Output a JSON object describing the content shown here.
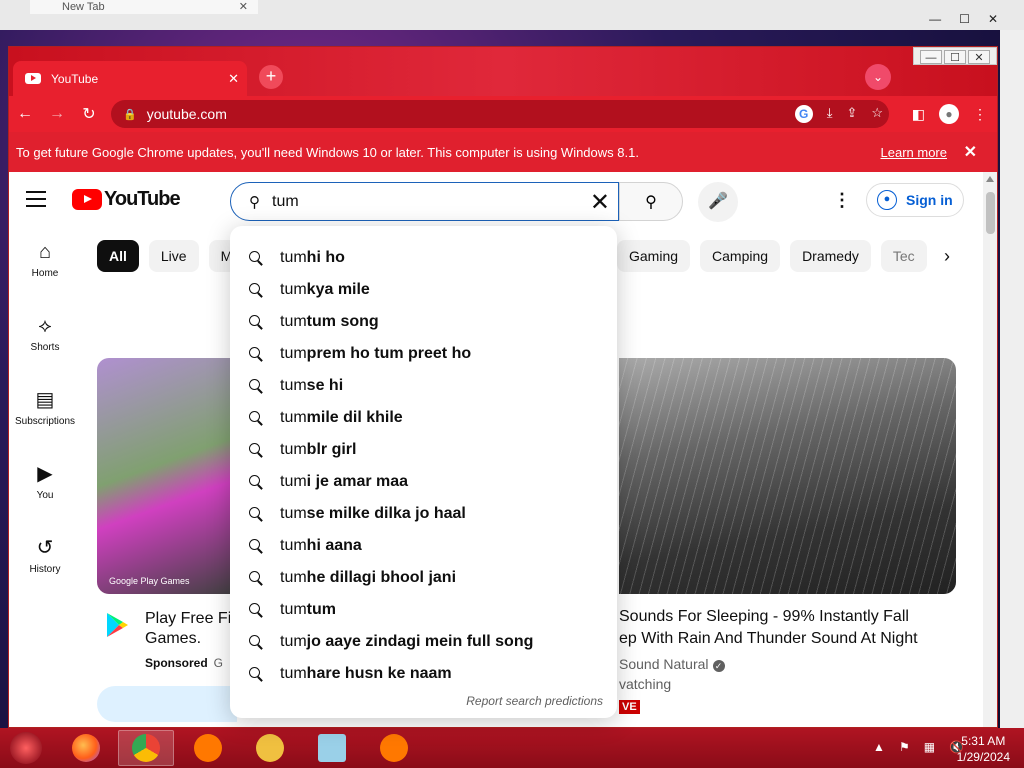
{
  "background_window": {
    "tab_title": "New Tab",
    "tab_close": "✕"
  },
  "window_controls": {
    "minimize": "—",
    "maximize": "☐",
    "close": "✕"
  },
  "chrome": {
    "tab_title": "YouTube",
    "tab_close": "✕",
    "new_tab": "+",
    "url": "youtube.com",
    "infobar_text": "To get future Google Chrome updates, you'll need Windows 10 or later. This computer is using Windows 8.1.",
    "infobar_link": "Learn more",
    "infobar_close": "✕"
  },
  "youtube": {
    "logo_text": "YouTube",
    "search_value": "tum",
    "sign_in": "Sign in",
    "guide": [
      {
        "label": "Home",
        "icon": "home-icon"
      },
      {
        "label": "Shorts",
        "icon": "shorts-icon"
      },
      {
        "label": "Subscriptions",
        "icon": "subscriptions-icon"
      },
      {
        "label": "You",
        "icon": "you-icon"
      },
      {
        "label": "History",
        "icon": "history-icon"
      }
    ],
    "chips_left": [
      "All",
      "Live",
      "M"
    ],
    "chips_right": [
      "Gaming",
      "Camping",
      "Dramedy",
      "Tec"
    ],
    "video1": {
      "title_line1": "Play Free Fi",
      "title_line2": "Games.",
      "sponsored": "Sponsored",
      "sponsor_suffix": "G",
      "thumb_badge": "Google Play Games"
    },
    "video2": {
      "title_line1": "Sounds For Sleeping - 99% Instantly Fall",
      "title_line2": "ep With Rain And Thunder Sound At Night",
      "channel": "Sound Natural",
      "verified": "✓",
      "watching": "vatching",
      "live": "VE"
    },
    "suggestions": [
      {
        "prefix": "tum",
        "rest": " hi ho"
      },
      {
        "prefix": "tum",
        "rest": " kya mile"
      },
      {
        "prefix": "tum",
        "rest": " tum song"
      },
      {
        "prefix": "tum",
        "rest": " prem ho tum preet ho"
      },
      {
        "prefix": "tum",
        "rest": " se hi"
      },
      {
        "prefix": "tum",
        "rest": " mile dil khile"
      },
      {
        "prefix": "tum",
        "rest": "blr girl"
      },
      {
        "prefix": "tum",
        "rest": "i je amar maa"
      },
      {
        "prefix": "tum",
        "rest": "se milke dilka jo haal"
      },
      {
        "prefix": "tum",
        "rest": " hi aana"
      },
      {
        "prefix": "tum",
        "rest": "he dillagi bhool jani"
      },
      {
        "prefix": "tum",
        "rest": " tum"
      },
      {
        "prefix": "tum",
        "rest": " jo aaye zindagi mein full song"
      },
      {
        "prefix": "tum",
        "rest": "hare husn ke naam"
      }
    ],
    "report_link": "Report search predictions"
  },
  "taskbar": {
    "time": "5:31 AM",
    "date": "1/29/2024",
    "apps": [
      "firefox-icon",
      "chrome-icon",
      "avast-icon",
      "keepass-icon",
      "notepad-icon",
      "avast-icon"
    ]
  },
  "colors": {
    "chrome_theme": "#e8202e",
    "yt_red": "#ff0000",
    "link_blue": "#065fd4"
  }
}
